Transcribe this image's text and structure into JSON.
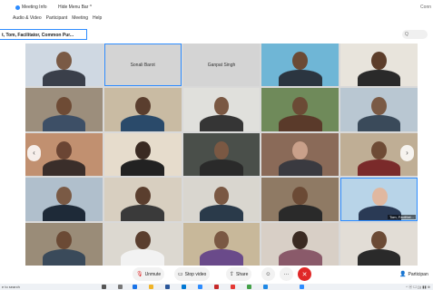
{
  "titlebar": {
    "meeting_info": "Meeting Info",
    "hide_menu": "Hide Menu Bar ^",
    "right_text": "Conn"
  },
  "menubar": [
    "Audio & Video",
    "Participant",
    "Meeting",
    "Help"
  ],
  "name_bar": "t, Tom, Facilitator, Common Pur...",
  "search": "Q",
  "tiles": [
    {
      "name": "",
      "bg": "#cfd8e2",
      "head": "#7a5a45",
      "body": "#3a3f4a"
    },
    {
      "name": "Sonali Barot",
      "bg": "#d4d4d4",
      "active": true
    },
    {
      "name": "Ganpat Singh",
      "bg": "#d4d4d4"
    },
    {
      "name": "",
      "bg": "#6fb6d6",
      "head": "#6b4a35",
      "body": "#2b3540"
    },
    {
      "name": "",
      "bg": "#e8e4dc",
      "head": "#5c3d2a",
      "body": "#2a2a2a"
    },
    {
      "name": "",
      "bg": "#9c8e7c",
      "head": "#6e4b35",
      "body": "#3d4f66"
    },
    {
      "name": "",
      "bg": "#c9bba3",
      "head": "#5a3e2e",
      "body": "#2a4a6a"
    },
    {
      "name": "",
      "bg": "#e0e0dc",
      "head": "#7a5843",
      "body": "#353535"
    },
    {
      "name": "",
      "bg": "#6f8a5a",
      "head": "#6b4a35",
      "body": "#5a3a2a"
    },
    {
      "name": "",
      "bg": "#b9c7d2",
      "head": "#7a5a45",
      "body": "#3a4a5a"
    },
    {
      "name": "",
      "bg": "#c19070",
      "head": "#6b4534",
      "body": "#3a2e2a"
    },
    {
      "name": "",
      "bg": "#e6dccc",
      "head": "#3a2a22",
      "body": "#222222"
    },
    {
      "name": "",
      "bg": "#4a4f4a",
      "head": "#7a5843",
      "body": "#2a2a2a"
    },
    {
      "name": "",
      "bg": "#8a6a58",
      "head": "#c9a08a",
      "body": "#3a3a40"
    },
    {
      "name": "",
      "bg": "#bfae95",
      "head": "#6e4b35",
      "body": "#7a2a2a"
    },
    {
      "name": "",
      "bg": "#b0bfcc",
      "head": "#7a5a45",
      "body": "#1e2a38"
    },
    {
      "name": "",
      "bg": "#d8cfc0",
      "head": "#5a3e2e",
      "body": "#3a3a3a"
    },
    {
      "name": "",
      "bg": "#d9d6cf",
      "head": "#7a5843",
      "body": "#2a3a4a"
    },
    {
      "name": "",
      "bg": "#8f7a64",
      "head": "#6b4a35",
      "body": "#2a2a2a"
    },
    {
      "name": "",
      "bg": "#b8d4e8",
      "head": "#e0b8a0",
      "body": "#2a3a55",
      "tag": "Tom, Facilitat...",
      "active": true
    },
    {
      "name": "",
      "bg": "#9a8c78",
      "head": "#6b4a35",
      "body": "#3a4a5a"
    },
    {
      "name": "",
      "bg": "#dcd8d0",
      "head": "#5a3e2e",
      "body": "#f2f2f2"
    },
    {
      "name": "",
      "bg": "#c8b89a",
      "head": "#7a5843",
      "body": "#6a4a8a"
    },
    {
      "name": "",
      "bg": "#d8cfc6",
      "head": "#3a2a22",
      "body": "#8a5a6a"
    },
    {
      "name": "",
      "bg": "#e2ddd6",
      "head": "#6b4a35",
      "body": "#2a2a2a"
    }
  ],
  "controls": {
    "unmute": "Unmute",
    "stop_video": "Stop video",
    "share": "Share",
    "participants": "Participan"
  },
  "taskbar": {
    "search": "e to search",
    "tray": "^ ⓦ ☐ ))) ▮▮ ⊕"
  },
  "colors": {
    "accent": "#2d8cff",
    "leave": "#e02828",
    "mute_icon": "#e02828"
  }
}
